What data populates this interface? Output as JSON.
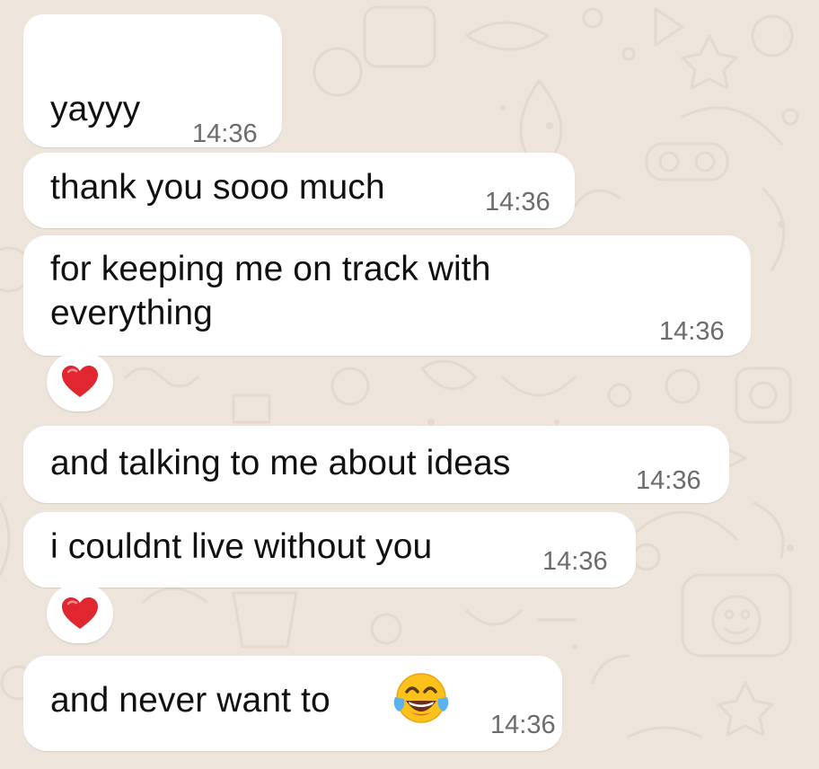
{
  "colors": {
    "chat_background": "#ede5dc",
    "bubble_background": "#ffffff",
    "text": "#111111",
    "timestamp": "#6b6b6b",
    "heart": "#e0262e"
  },
  "messages": [
    {
      "text": "",
      "time": "",
      "note": ""
    },
    {
      "text": "yayyy",
      "time": "14:36"
    },
    {
      "text": "thank you sooo much",
      "time": "14:36"
    },
    {
      "text_line1": "for keeping me on track with",
      "text_line2": "everything",
      "time": "14:36",
      "reaction_icon": "red-heart-icon"
    },
    {
      "text": "and talking to me about ideas",
      "time": "14:36"
    },
    {
      "text": "i couldnt live without you",
      "time": "14:36",
      "reaction_icon": "red-heart-icon"
    },
    {
      "text": "and never want to",
      "emoji_icon": "tears-of-joy-emoji-icon",
      "time": "14:36"
    }
  ]
}
